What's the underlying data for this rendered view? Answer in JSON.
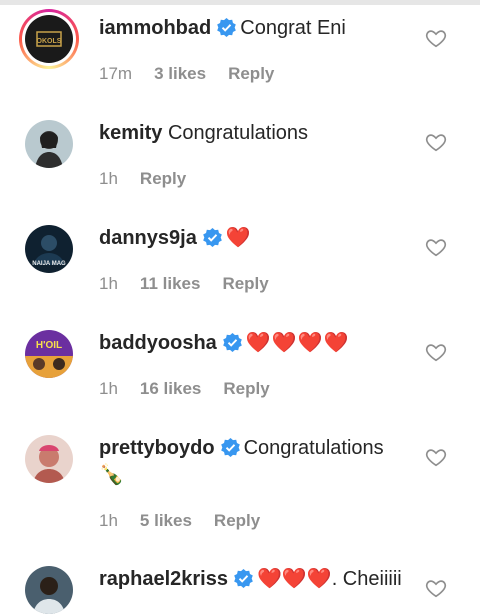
{
  "colors": {
    "verified_blue": "#3897f0",
    "heart_red": "#e0142b",
    "meta_gray": "#8e8e8e"
  },
  "comments": [
    {
      "username": "iammohbad",
      "verified": true,
      "text": "Congrat Eni",
      "time": "17m",
      "likes": "3 likes",
      "reply": "Reply",
      "avatar_label": "OKOLS"
    },
    {
      "username": "kemity",
      "verified": false,
      "text": "Congratulations",
      "time": "1h",
      "likes": "",
      "reply": "Reply"
    },
    {
      "username": "dannys9ja",
      "verified": true,
      "text": "❤️",
      "time": "1h",
      "likes": "11 likes",
      "reply": "Reply",
      "avatar_label": "NAIJA MAG"
    },
    {
      "username": "baddyoosha",
      "verified": true,
      "text": "❤️❤️❤️❤️",
      "time": "1h",
      "likes": "16 likes",
      "reply": "Reply",
      "avatar_label": "H'OIL"
    },
    {
      "username": "prettyboydo",
      "verified": true,
      "text": "Congratulations",
      "text_line2": "🍾",
      "time": "1h",
      "likes": "5 likes",
      "reply": "Reply"
    },
    {
      "username": "raphael2kriss",
      "verified": true,
      "text": "❤️❤️❤️. Cheiiiii",
      "time": "",
      "likes": "",
      "reply": ""
    }
  ],
  "icons": {
    "like": "heart-outline-icon",
    "verified": "verified-badge-icon"
  }
}
